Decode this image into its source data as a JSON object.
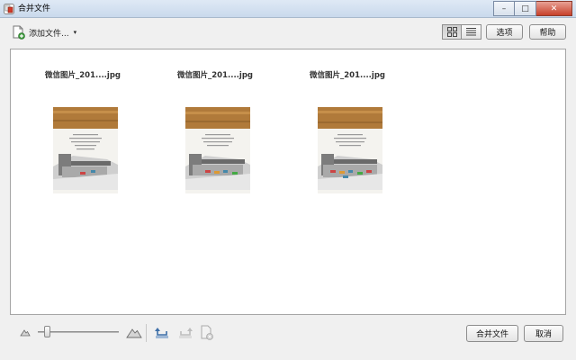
{
  "window": {
    "title": "合并文件",
    "minimize_glyph": "–",
    "maximize_glyph": "□",
    "close_glyph": "✕"
  },
  "toolbar": {
    "add_files_label": "添加文件...",
    "add_files_caret": "▾",
    "options_label": "选项",
    "help_label": "帮助"
  },
  "files": [
    {
      "name": "微信图片_201....jpg"
    },
    {
      "name": "微信图片_201....jpg"
    },
    {
      "name": "微信图片_201....jpg"
    }
  ],
  "footer": {
    "merge_label": "合并文件",
    "cancel_label": "取消"
  },
  "icons": {
    "app": "acrobat-combine-icon",
    "add_files": "add-file-icon",
    "grid_view": "grid-view-icon",
    "list_view": "list-view-icon",
    "zoom_small": "small-mountain-icon",
    "zoom_large": "large-mountain-icon",
    "rotate_left": "rotate-left-icon",
    "rotate_right": "rotate-right-icon",
    "remove": "remove-page-icon"
  },
  "colors": {
    "titlebar": "#c9d9ec",
    "close_button": "#c7402a",
    "panel_border": "#a5a5a5",
    "thumb_wood": "#b07a3a"
  }
}
